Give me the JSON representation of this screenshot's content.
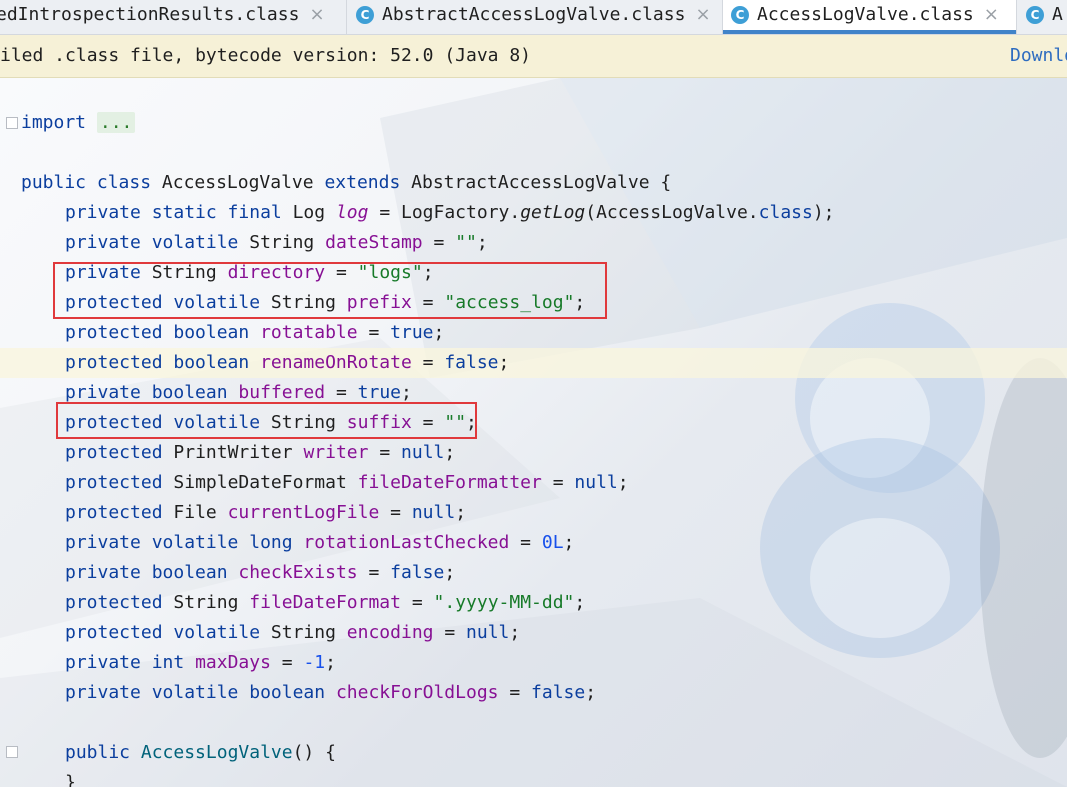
{
  "tabs": [
    {
      "label": "edIntrospectionResults.class",
      "icon": "class-icon",
      "active": false
    },
    {
      "label": "AbstractAccessLogValve.class",
      "icon": "class-icon",
      "active": false
    },
    {
      "label": "AccessLogValve.class",
      "icon": "class-icon",
      "active": true
    },
    {
      "label": "A",
      "icon": "class-icon",
      "active": false
    }
  ],
  "tab_close_glyph": "×",
  "tab_icon_glyph": "C",
  "banner": {
    "text": "iled .class file, bytecode version: 52.0 (Java 8)",
    "link": "Downlo"
  },
  "code": {
    "import_kw": "import",
    "import_fold": "...",
    "class_decl": {
      "mods": "public class",
      "name": "AccessLogValve",
      "extends_kw": "extends",
      "parent": "AbstractAccessLogValve",
      "brace": "{"
    },
    "fields": [
      {
        "mods": "private static final",
        "type": "Log",
        "name": "log",
        "eq": "=",
        "value": "LogFactory.",
        "method": "getLog",
        "args": "(AccessLogValve.",
        "kw2": "class",
        "end": ");"
      },
      {
        "mods": "private volatile",
        "type": "String",
        "name": "dateStamp",
        "eq": "=",
        "value": "\"\"",
        "end": ";"
      },
      {
        "mods": "private",
        "type": "String",
        "name": "directory",
        "eq": "=",
        "value": "\"logs\"",
        "end": ";"
      },
      {
        "mods": "protected volatile",
        "type": "String",
        "name": "prefix",
        "eq": "=",
        "value": "\"access_log\"",
        "end": ";"
      },
      {
        "mods": "protected boolean",
        "type": "",
        "name": "rotatable",
        "eq": "=",
        "value": "true",
        "end": ";"
      },
      {
        "mods": "protected boolean",
        "type": "",
        "name": "renameOnRotate",
        "eq": "=",
        "value": "false",
        "end": ";"
      },
      {
        "mods": "private boolean",
        "type": "",
        "name": "buffered",
        "eq": "=",
        "value": "true",
        "end": ";"
      },
      {
        "mods": "protected volatile",
        "type": "String",
        "name": "suffix",
        "eq": "=",
        "value": "\"\"",
        "end": ";"
      },
      {
        "mods": "protected",
        "type": "PrintWriter",
        "name": "writer",
        "eq": "=",
        "value": "null",
        "end": ";"
      },
      {
        "mods": "protected",
        "type": "SimpleDateFormat",
        "name": "fileDateFormatter",
        "eq": "=",
        "value": "null",
        "end": ";"
      },
      {
        "mods": "protected",
        "type": "File",
        "name": "currentLogFile",
        "eq": "=",
        "value": "null",
        "end": ";"
      },
      {
        "mods": "private volatile long",
        "type": "",
        "name": "rotationLastChecked",
        "eq": "=",
        "value": "0L",
        "end": ";"
      },
      {
        "mods": "private boolean",
        "type": "",
        "name": "checkExists",
        "eq": "=",
        "value": "false",
        "end": ";"
      },
      {
        "mods": "protected",
        "type": "String",
        "name": "fileDateFormat",
        "eq": "=",
        "value": "\".yyyy-MM-dd\"",
        "end": ";"
      },
      {
        "mods": "protected volatile",
        "type": "String",
        "name": "encoding",
        "eq": "=",
        "value": "null",
        "end": ";"
      },
      {
        "mods": "private int",
        "type": "",
        "name": "maxDays",
        "eq": "=",
        "value": "-1",
        "end": ";"
      },
      {
        "mods": "private volatile boolean",
        "type": "",
        "name": "checkForOldLogs",
        "eq": "=",
        "value": "false",
        "end": ";"
      }
    ],
    "ctor": {
      "mods": "public",
      "name": "AccessLogValve",
      "sig": "() {"
    },
    "close_brace": "}"
  },
  "colors": {
    "keyword": "#0b3e9e",
    "field": "#871094",
    "string": "#177a29",
    "number": "#1750eb",
    "method": "#00627a",
    "annotation_box": "#e0393c",
    "active_tab_underline": "#4083c9"
  }
}
